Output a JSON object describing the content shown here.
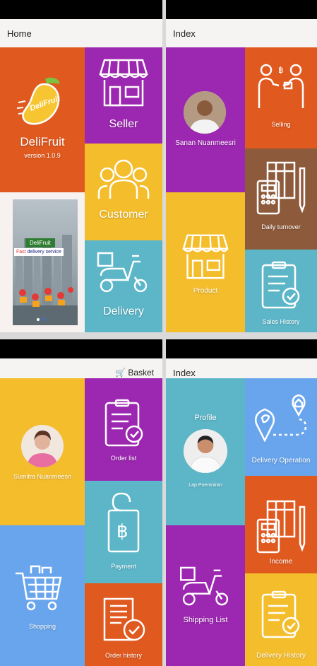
{
  "screens": {
    "home": {
      "title": "Home",
      "app_name": "DeliFruit",
      "version": "version 1.0.9",
      "logo_text": "DeliFruit",
      "banner": {
        "brand": "DeliFruit",
        "tagline_accent": "Fast",
        "tagline": " delivery service"
      },
      "tiles": {
        "seller": "Seller",
        "customer": "Customer",
        "delivery": "Delivery"
      }
    },
    "seller": {
      "title": "Index",
      "user_name": "Sanan Nuanmeesri",
      "tiles": {
        "selling": "Selling",
        "daily_turnover": "Daily turnover",
        "product": "Product",
        "sales_history": "Sales History"
      }
    },
    "customer": {
      "basket_label": "Basket",
      "user_name": "Sumitra Nuanmeesri",
      "tiles": {
        "order_list": "Order list",
        "payment": "Payment",
        "shopping": "Shopping",
        "order_history": "Order history"
      }
    },
    "delivery": {
      "title": "Index",
      "profile_label": "Profile",
      "user_name": "Lap Poemniran",
      "tiles": {
        "delivery_operation": "Delivery Operation",
        "income": "Income",
        "shipping_list": "Shipping List",
        "delivery_history": "Delivery History"
      }
    }
  },
  "colors": {
    "orange": "#e0591f",
    "purple": "#9c27b0",
    "yellow": "#f4bd2c",
    "teal": "#5cb6c8",
    "brown": "#8d5a3b",
    "blue": "#69a5ec",
    "appbar": "#f6f4f2"
  }
}
